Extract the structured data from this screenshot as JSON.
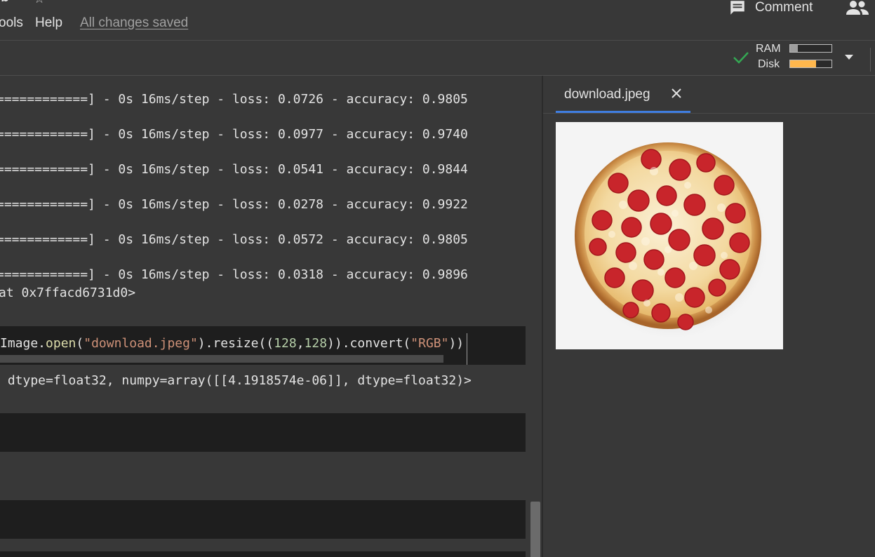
{
  "header": {
    "title_fragment": "ıb",
    "menu": [
      "ools",
      "Help"
    ],
    "save_status": "All changes saved",
    "comment_label": "Comment"
  },
  "toolbar": {
    "ram_label": "RAM",
    "disk_label": "Disk",
    "ram_usage": 0.18,
    "disk_usage": 0.62
  },
  "notebook": {
    "training_log": [
      "============] - 0s 16ms/step - loss: 0.0726 - accuracy: 0.9805",
      "============] - 0s 16ms/step - loss: 0.0977 - accuracy: 0.9740",
      "============] - 0s 16ms/step - loss: 0.0541 - accuracy: 0.9844",
      "============] - 0s 16ms/step - loss: 0.0278 - accuracy: 0.9922",
      "============] - 0s 16ms/step - loss: 0.0572 - accuracy: 0.9805",
      "============] - 0s 16ms/step - loss: 0.0318 - accuracy: 0.9896"
    ],
    "object_repr": "at 0x7ffacd6731d0>",
    "code": {
      "p1": "Image.",
      "fn": "open",
      "p2": "(",
      "str1": "\"download.jpeg\"",
      "p3": ").resize((",
      "n1": "128",
      "comma": ",",
      "n2": "128",
      "p4": ")).convert(",
      "str2": "\"RGB\"",
      "p5": "))"
    },
    "prediction_output": " dtype=float32, numpy=array([[4.1918574e-06]], dtype=float32)>"
  },
  "viewer": {
    "tab_label": "download.jpeg"
  },
  "colors": {
    "accent": "#3f7de0",
    "check": "#34a853",
    "disk_bar": "#ffb74d"
  }
}
